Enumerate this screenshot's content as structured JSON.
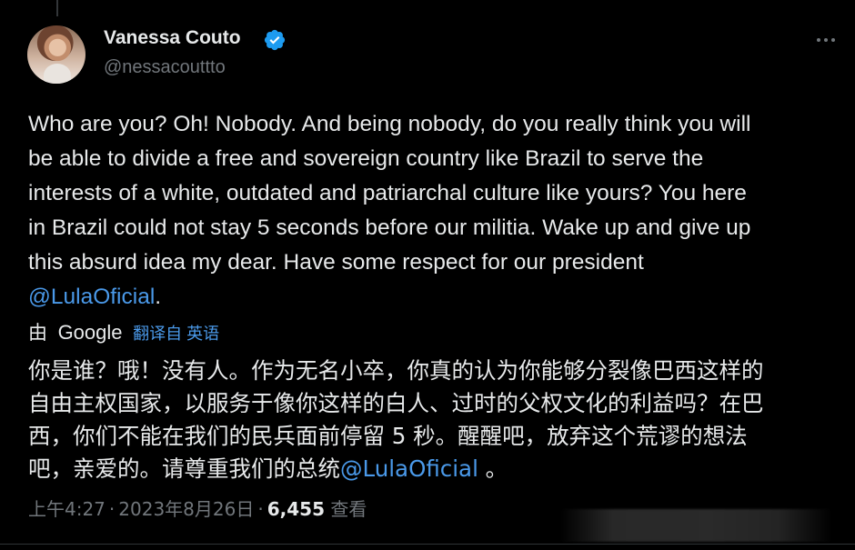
{
  "author": {
    "display_name": "Vanessa Couto",
    "handle": "@nessacouttto",
    "verified_icon": "verified-badge-icon",
    "more_icon": "more-options-icon"
  },
  "tweet": {
    "lines": [
      "Who are you? Oh! Nobody. And being nobody, do you really think you will",
      "be able to divide a free and sovereign country like Brazil to serve the",
      "interests of a white, outdated and patriarchal culture like yours? You here",
      "in Brazil could not stay 5 seconds before our militia. Wake up and give up",
      "this absurd idea my dear. Have some respect for our president"
    ],
    "mention": "@LulaOficial",
    "mention_suffix": "."
  },
  "translation": {
    "by_label": "由",
    "provider": "Google",
    "link_label": "翻译自 英语",
    "lines": [
      "你是谁？哦！没有人。作为无名小卒，你真的认为你能够分裂像巴西这样的",
      "自由主权国家，以服务于像你这样的白人、过时的父权文化的利益吗？在巴",
      "西，你们不能在我们的民兵面前停留 5 秒。醒醒吧，放弃这个荒谬的想法"
    ],
    "last_line_prefix": "吧，亲爱的。请尊重我们的总统",
    "mention": "@LulaOficial",
    "last_line_suffix": " 。"
  },
  "meta": {
    "time": "上午4:27",
    "separator": "·",
    "date": "2023年8月26日",
    "views_count": "6,455",
    "views_label": "查看"
  },
  "colors": {
    "background": "#000000",
    "text": "#e7e9ea",
    "muted": "#71767b",
    "link": "#4a99e9",
    "verified": "#1d9bf0"
  }
}
